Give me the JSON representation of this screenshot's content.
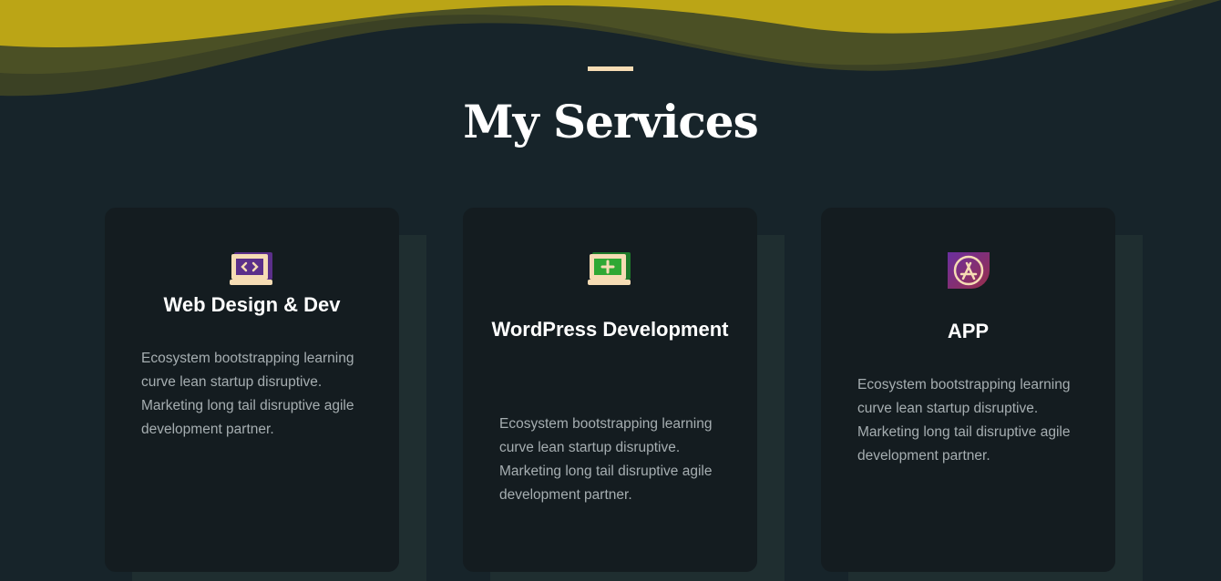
{
  "section": {
    "title": "My Services"
  },
  "colors": {
    "background": "#17242a",
    "card": "#141c20",
    "wave_gold": "#bba516",
    "wave_olive": "#4b5025",
    "accent": "#f6dcb4"
  },
  "services": [
    {
      "icon": "laptop-code-icon",
      "title": "Web Design & Dev",
      "description": "Ecosystem bootstrapping learning curve lean startup disruptive. Marketing long tail disruptive agile development partner."
    },
    {
      "icon": "laptop-plus-icon",
      "title": "WordPress Development",
      "description": "Ecosystem bootstrapping learning curve lean startup disruptive. Marketing long tail disruptive agile development partner."
    },
    {
      "icon": "app-store-icon",
      "title": "APP",
      "description": "Ecosystem bootstrapping learning curve lean startup disruptive. Marketing long tail disruptive agile development partner."
    }
  ]
}
